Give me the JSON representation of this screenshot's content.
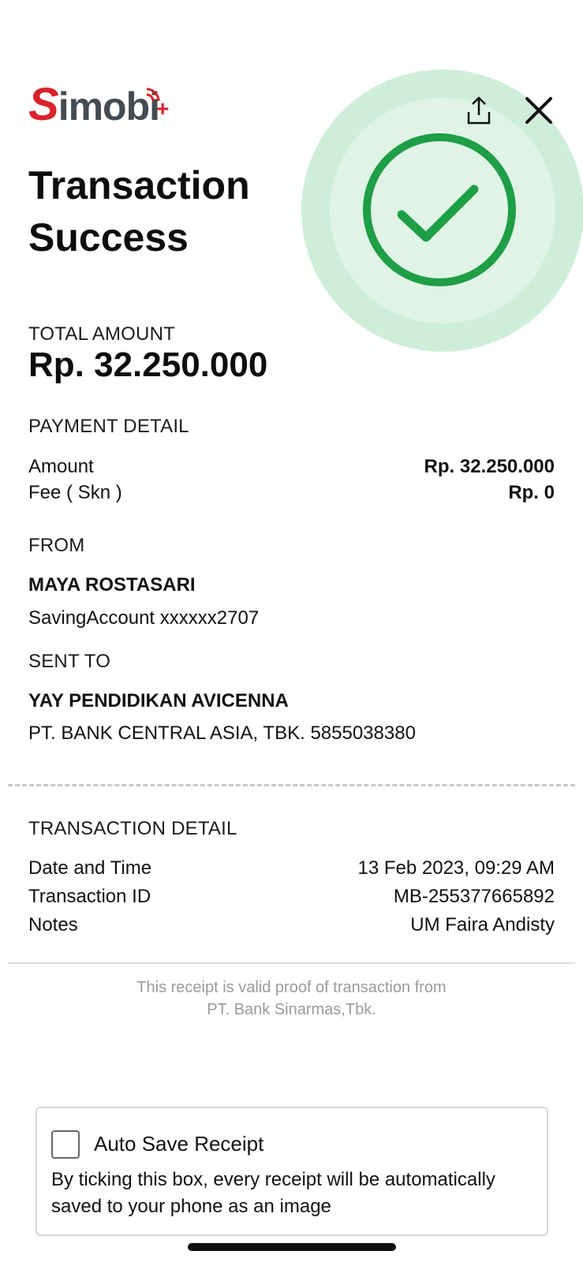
{
  "brand": {
    "logo_s": "S",
    "logo_rest": "imobi",
    "logo_plus": "+",
    "accent": "#d8232a",
    "success_color": "#1e9e47"
  },
  "header": {
    "share_icon": "share-icon",
    "close_icon": "close-icon"
  },
  "title": "Transaction Success",
  "total": {
    "label": "TOTAL AMOUNT",
    "value": "Rp. 32.250.000"
  },
  "payment": {
    "label": "PAYMENT DETAIL",
    "amount_label": "Amount",
    "amount_value": "Rp. 32.250.000",
    "fee_label": "Fee ( Skn )",
    "fee_value": "Rp. 0"
  },
  "from": {
    "label": "FROM",
    "name": "MAYA ROSTASARI",
    "account": "SavingAccount xxxxxx2707"
  },
  "sent_to": {
    "label": "SENT TO",
    "name": "YAY PENDIDIKAN AVICENNA",
    "account": "PT. BANK CENTRAL ASIA, TBK. 5855038380"
  },
  "transaction": {
    "label": "TRANSACTION DETAIL",
    "date_label": "Date and Time",
    "date_value": "13 Feb 2023, 09:29 AM",
    "id_label": "Transaction ID",
    "id_value": "MB-255377665892",
    "notes_label": "Notes",
    "notes_value": "UM Faira Andisty"
  },
  "receipt_note": {
    "line1": "This receipt is valid proof of transaction from",
    "line2": "PT. Bank Sinarmas,Tbk."
  },
  "auto_save": {
    "title": "Auto Save Receipt",
    "description": "By ticking this box, every receipt will be automatically saved to your phone as an image",
    "checked": false
  }
}
